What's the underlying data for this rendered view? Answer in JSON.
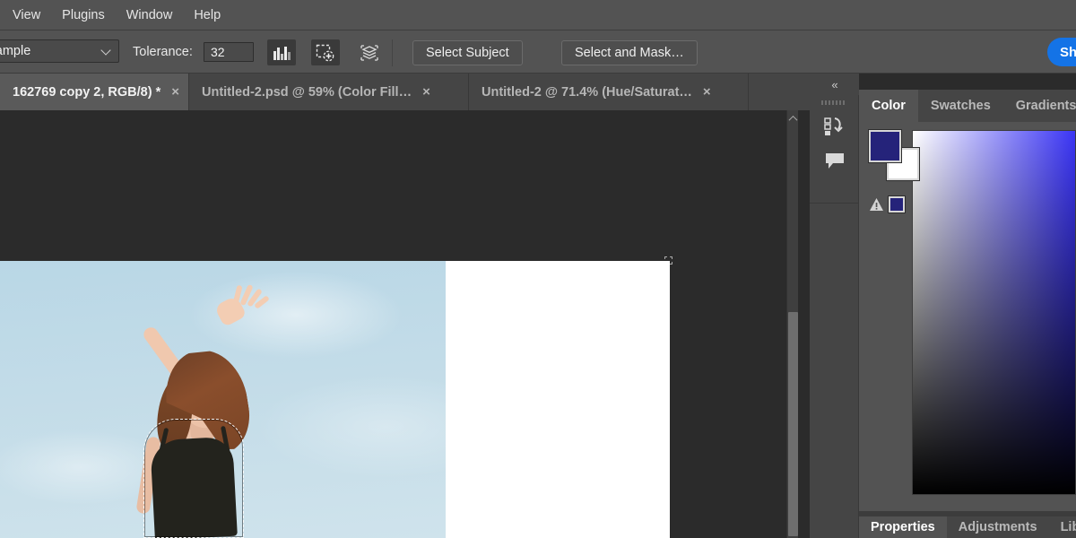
{
  "menu": {
    "items": [
      {
        "label": "View"
      },
      {
        "label": "Plugins"
      },
      {
        "label": "Window"
      },
      {
        "label": "Help"
      }
    ]
  },
  "options_bar": {
    "sample_dropdown_value": "nt Sample",
    "tolerance_label": "Tolerance:",
    "tolerance_value": "32",
    "icons": [
      {
        "name": "anti-alias-icon",
        "active": true
      },
      {
        "name": "add-to-selection-icon",
        "active": true
      },
      {
        "name": "sample-all-layers-icon",
        "active": false
      }
    ],
    "select_subject_label": "Select Subject",
    "select_and_mask_label": "Select and Mask…",
    "share_label": "Sh",
    "share_color": "#1473e6"
  },
  "document_tabs": [
    {
      "title": "162769 copy 2, RGB/8) *",
      "close": "×",
      "active": true
    },
    {
      "title": "Untitled-2.psd @ 59% (Color Fill…",
      "close": "×",
      "active": false
    },
    {
      "title": "Untitled-2 @ 71.4% (Hue/Saturat…",
      "close": "×",
      "active": false
    }
  ],
  "canvas": {
    "background_color": "#2b2b2b",
    "document_background": "#ffffff",
    "sky_color": "#c3dce8",
    "scrollbar": {
      "up_arrow": "▲"
    }
  },
  "right_dock": {
    "collapse_label": "«",
    "rail_icons": [
      {
        "name": "history-icon"
      },
      {
        "name": "comments-icon"
      }
    ],
    "color_panel": {
      "tabs": [
        {
          "label": "Color",
          "active": true
        },
        {
          "label": "Swatches",
          "active": false
        },
        {
          "label": "Gradients",
          "active": false
        }
      ],
      "foreground_color": "#25237a",
      "background_color": "#ffffff",
      "gamut_warning_color": "#25237a"
    },
    "bottom_tabs": [
      {
        "label": "Properties",
        "active": true
      },
      {
        "label": "Adjustments",
        "active": false
      },
      {
        "label": "Libra",
        "active": false
      }
    ]
  }
}
